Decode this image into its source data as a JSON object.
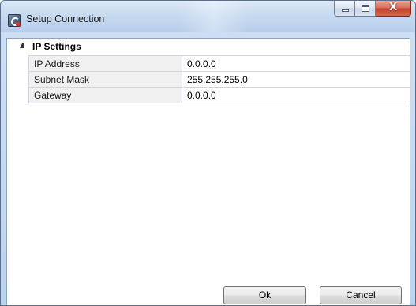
{
  "window": {
    "title": "Setup Connection",
    "icon": "app-icon"
  },
  "caption_buttons": {
    "minimize_icon": "minimize-icon",
    "maximize_icon": "maximize-icon",
    "close_glyph": "X"
  },
  "group": {
    "title": "IP Settings",
    "expanded": true
  },
  "properties": [
    {
      "label": "IP Address",
      "value": "0.0.0.0"
    },
    {
      "label": "Subnet Mask",
      "value": "255.255.255.0"
    },
    {
      "label": "Gateway",
      "value": "0.0.0.0"
    }
  ],
  "buttons": {
    "ok_label": "Ok",
    "cancel_label": "Cancel"
  },
  "colors": {
    "close_button": "#c4432c",
    "label_cell_background": "#f0f0f0",
    "title_bar": "#c7daf0"
  }
}
